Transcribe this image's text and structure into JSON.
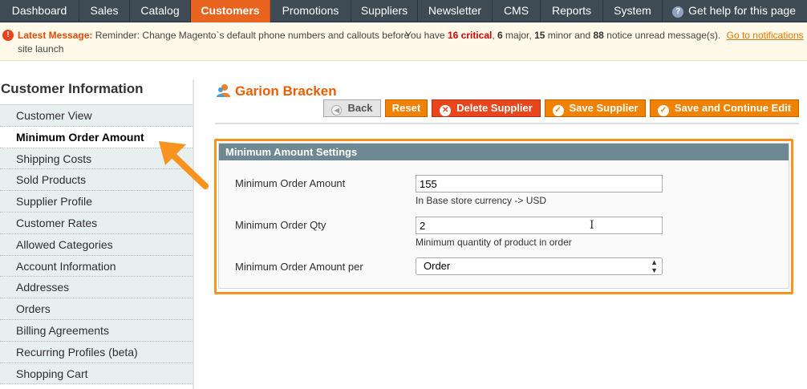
{
  "nav": {
    "items": [
      "Dashboard",
      "Sales",
      "Catalog",
      "Customers",
      "Promotions",
      "Suppliers",
      "Newsletter",
      "CMS",
      "Reports",
      "System"
    ],
    "active": "Customers",
    "help": "Get help for this page"
  },
  "notice": {
    "label": "Latest Message:",
    "text": "Reminder: Change Magento`s default phone numbers and callouts before site launch",
    "counts_prefix": "You have",
    "critical": "16 critical",
    "major": "6",
    "major_suffix": "major,",
    "minor": "15",
    "minor_suffix": "minor and",
    "notice": "88",
    "notice_suffix": "notice unread message(s).",
    "link": "Go to notifications"
  },
  "sidebar": {
    "title": "Customer Information",
    "items": [
      {
        "label": "Customer View"
      },
      {
        "label": "Minimum Order Amount"
      },
      {
        "label": "Shipping Costs"
      },
      {
        "label": "Sold Products"
      },
      {
        "label": "Supplier Profile"
      },
      {
        "label": "Customer Rates"
      },
      {
        "label": "Allowed Categories"
      },
      {
        "label": "Account Information"
      },
      {
        "label": "Addresses"
      },
      {
        "label": "Orders"
      },
      {
        "label": "Billing Agreements"
      },
      {
        "label": "Recurring Profiles (beta)"
      },
      {
        "label": "Shopping Cart"
      }
    ],
    "active_index": 1
  },
  "page": {
    "title": "Garion Bracken"
  },
  "buttons": {
    "back": "Back",
    "reset": "Reset",
    "delete": "Delete Supplier",
    "save": "Save Supplier",
    "save_continue": "Save and Continue Edit"
  },
  "form": {
    "heading": "Minimum Amount Settings",
    "min_amount_label": "Minimum Order Amount",
    "min_amount_value": "155",
    "min_amount_note": "In Base store currency -> USD",
    "min_qty_label": "Minimum Order Qty",
    "min_qty_value": "2",
    "min_qty_note": "Minimum quantity of product in order",
    "per_label": "Minimum Order Amount per",
    "per_value": "Order"
  },
  "colors": {
    "accent": "#e9651f",
    "nav_bg": "#3e4a54",
    "annotation": "#f7931e"
  }
}
